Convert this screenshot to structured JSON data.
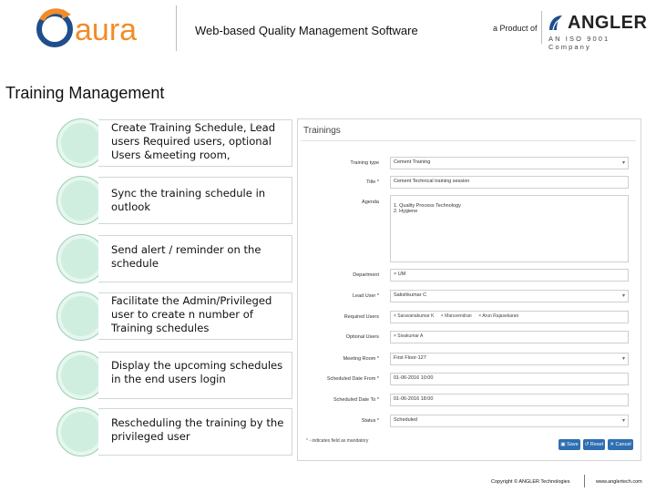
{
  "header": {
    "logo_text": "aura",
    "title": "Web-based Quality Management Software",
    "product_of": "a Product of",
    "company_name": "ANGLER",
    "company_sub": "AN ISO 9001 Company"
  },
  "page_title": "Training Management",
  "features": [
    "Create Training Schedule, Lead users  Required users, optional Users &meeting room,",
    "Sync the training schedule in outlook",
    "Send alert / reminder on the schedule",
    "Facilitate the Admin/Privileged user to create n number of Training schedules",
    "Display the upcoming schedules in the end users login",
    "Rescheduling the training by the privileged user"
  ],
  "form": {
    "title": "Trainings",
    "fields": {
      "training_type": {
        "label": "Training type",
        "value": "Cement Training"
      },
      "title": {
        "label": "Title *",
        "value": "Cement Technical training session"
      },
      "agenda": {
        "label": "Agenda",
        "value": "1. Quality Process Technology\n2. Hygiene"
      },
      "department": {
        "label": "Department",
        "value": "× UM"
      },
      "lead_user": {
        "label": "Lead User *",
        "value": "Satishkumar C"
      },
      "required_users": {
        "label": "Required Users",
        "tags": [
          "× Saravanakumar K",
          "× Maruvendran",
          "× Arun Rajasekaran"
        ]
      },
      "optional_users": {
        "label": "Optional Users",
        "tags": [
          "× Sivakumar A"
        ]
      },
      "meeting_room": {
        "label": "Meeting Room *",
        "value": "First Floor-127"
      },
      "scheduled_date_from": {
        "label": "Scheduled Date From *",
        "value": "01-06-2016 10:00"
      },
      "scheduled_date_to": {
        "label": "Scheduled Date To *",
        "value": "01-06-2016 18:00"
      },
      "status": {
        "label": "Status *",
        "value": "Scheduled"
      }
    },
    "required_note_star": "*",
    "required_note": "- indicates field as mandatory",
    "buttons": {
      "save": "Save",
      "reset": "Reset",
      "cancel": "Cancel"
    }
  },
  "footer": {
    "copyright": "Copyright © ANGLER Technologies",
    "website": "www.anglertech.com"
  },
  "colors": {
    "logo_orange": "#f28c28",
    "logo_blue": "#1f4e8c",
    "circle_fill": "#cfeee0",
    "button_blue": "#2f6fb0"
  }
}
